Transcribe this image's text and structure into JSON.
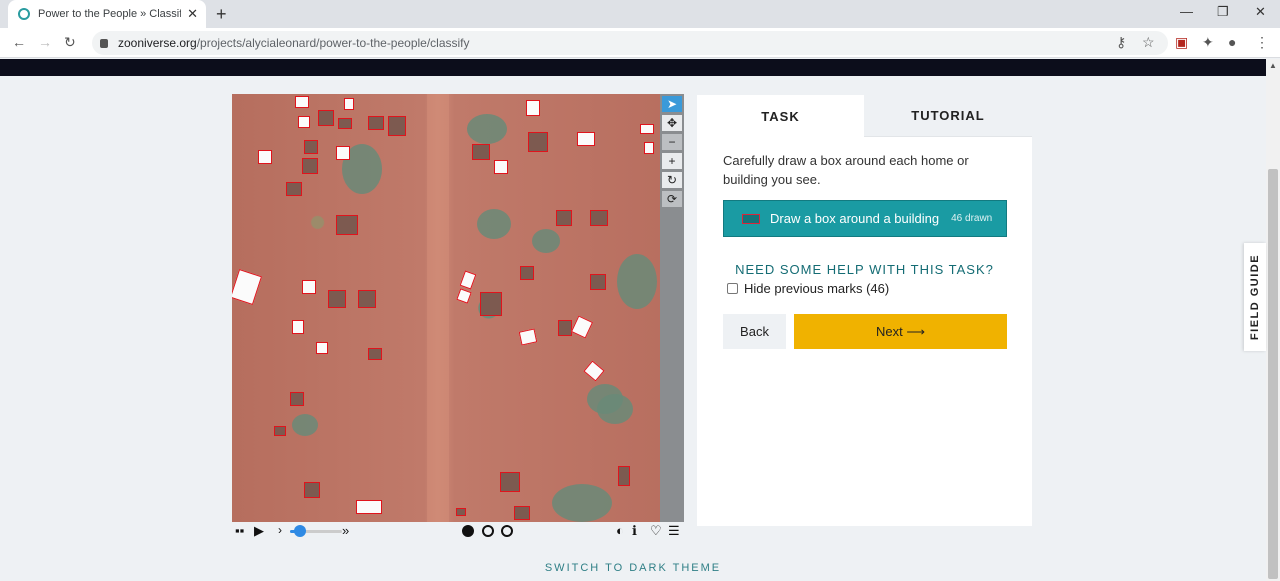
{
  "browser": {
    "tab_title": "Power to the People » Classify —",
    "url_domain": "zooniverse.org",
    "url_path": "/projects/alycialeonard/power-to-the-people/classify"
  },
  "task_panel": {
    "tab_task": "TASK",
    "tab_tutorial": "TUTORIAL",
    "instructions": "Carefully draw a box around each home or building you see.",
    "tool_label": "Draw a box around a building",
    "tool_count": "46 drawn",
    "help_link": "NEED SOME HELP WITH THIS TASK?",
    "hide_marks": "Hide previous marks (46)",
    "back_label": "Back",
    "next_label": "Next ⟶"
  },
  "field_guide": "FIELD GUIDE",
  "footer": {
    "dark_theme": "SWITCH TO DARK THEME"
  },
  "colors": {
    "teal": "#1a9ba3",
    "next": "#f0b200",
    "mark": "#e0141c"
  },
  "icons": {
    "viewer_tools": [
      "pointer-icon",
      "move-icon",
      "zoom-out-icon",
      "zoom-in-icon",
      "rotate-icon",
      "reset-icon"
    ],
    "viewer_bar": [
      "grid-icon",
      "play-icon",
      "contrast-icon",
      "info-icon",
      "favorite-icon",
      "collections-icon"
    ]
  },
  "frames": {
    "count": 3,
    "current": 1
  }
}
